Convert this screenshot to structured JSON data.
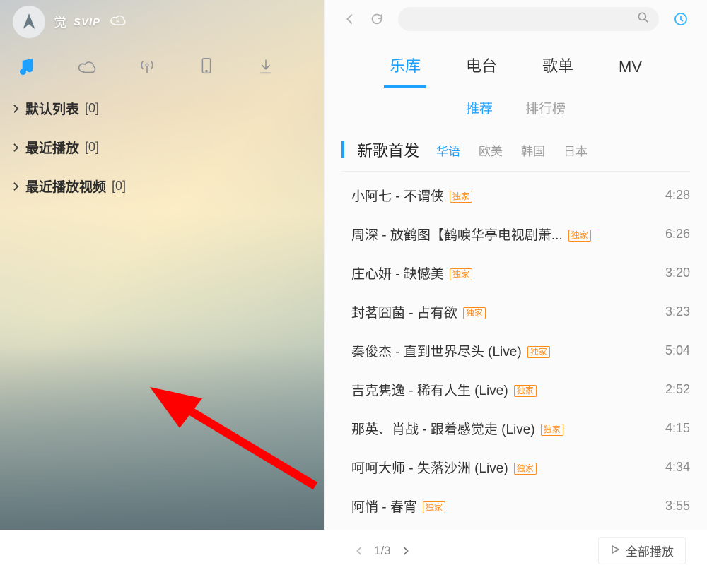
{
  "user": {
    "name": "觉",
    "badge": "SVIP"
  },
  "sidebar": {
    "playlists": [
      {
        "label": "默认列表",
        "count": "[0]"
      },
      {
        "label": "最近播放",
        "count": "[0]"
      },
      {
        "label": "最近播放视频",
        "count": "[0]"
      }
    ]
  },
  "top_tabs": [
    "乐库",
    "电台",
    "歌单",
    "MV"
  ],
  "top_tabs_active": 0,
  "sub_tabs": [
    "推荐",
    "排行榜"
  ],
  "sub_tabs_active": 0,
  "section": {
    "title": "新歌首发",
    "filters": [
      "华语",
      "欧美",
      "韩国",
      "日本"
    ],
    "filters_active": 0,
    "badge_text": "独家",
    "songs": [
      {
        "title": "小阿七 - 不谓侠",
        "duration": "4:28"
      },
      {
        "title": "周深 - 放鹤图【鹤唳华亭电视剧萧...",
        "duration": "6:26"
      },
      {
        "title": "庄心妍 - 缺憾美",
        "duration": "3:20"
      },
      {
        "title": "封茗囧菌 - 占有欲",
        "duration": "3:23"
      },
      {
        "title": "秦俊杰 - 直到世界尽头 (Live)",
        "duration": "5:04"
      },
      {
        "title": "吉克隽逸 - 稀有人生 (Live)",
        "duration": "2:52"
      },
      {
        "title": "那英、肖战 - 跟着感觉走 (Live)",
        "duration": "4:15"
      },
      {
        "title": "呵呵大师 - 失落沙洲 (Live)",
        "duration": "4:34"
      },
      {
        "title": "阿悄 - 春宵",
        "duration": "3:55"
      }
    ],
    "pager": {
      "text": "1/3",
      "play_all": "全部播放"
    }
  }
}
